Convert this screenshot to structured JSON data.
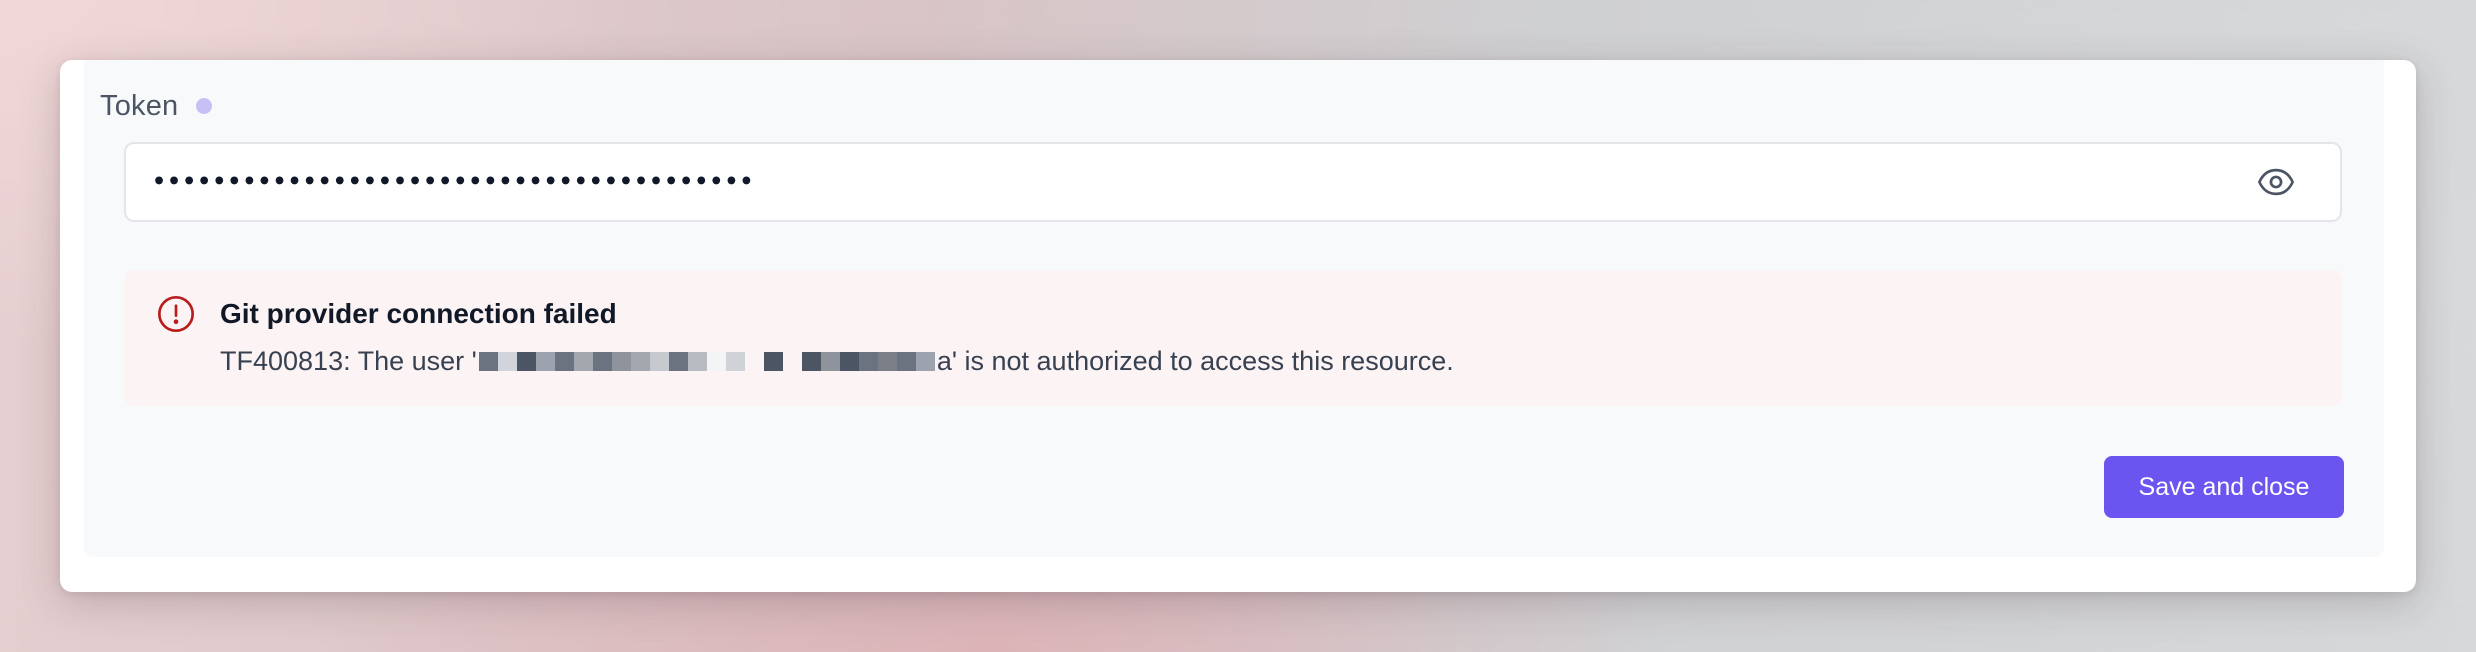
{
  "token": {
    "label": "Token",
    "value": "••••••••••••••••••••••••••••••••••••••••",
    "reveal_icon": "eye-icon",
    "required_indicator_color": "#c7c0f4"
  },
  "alert": {
    "icon": "exclamation-circle-icon",
    "title": "Git provider connection failed",
    "message_prefix": "TF400813: The user '",
    "message_redacted_tail": "a",
    "message_suffix": "' is not authorized to access this resource.",
    "accent_color": "#b91c1c",
    "background_color": "#fcf4f4"
  },
  "actions": {
    "save_label": "Save and close",
    "save_color": "#6a55f0"
  }
}
